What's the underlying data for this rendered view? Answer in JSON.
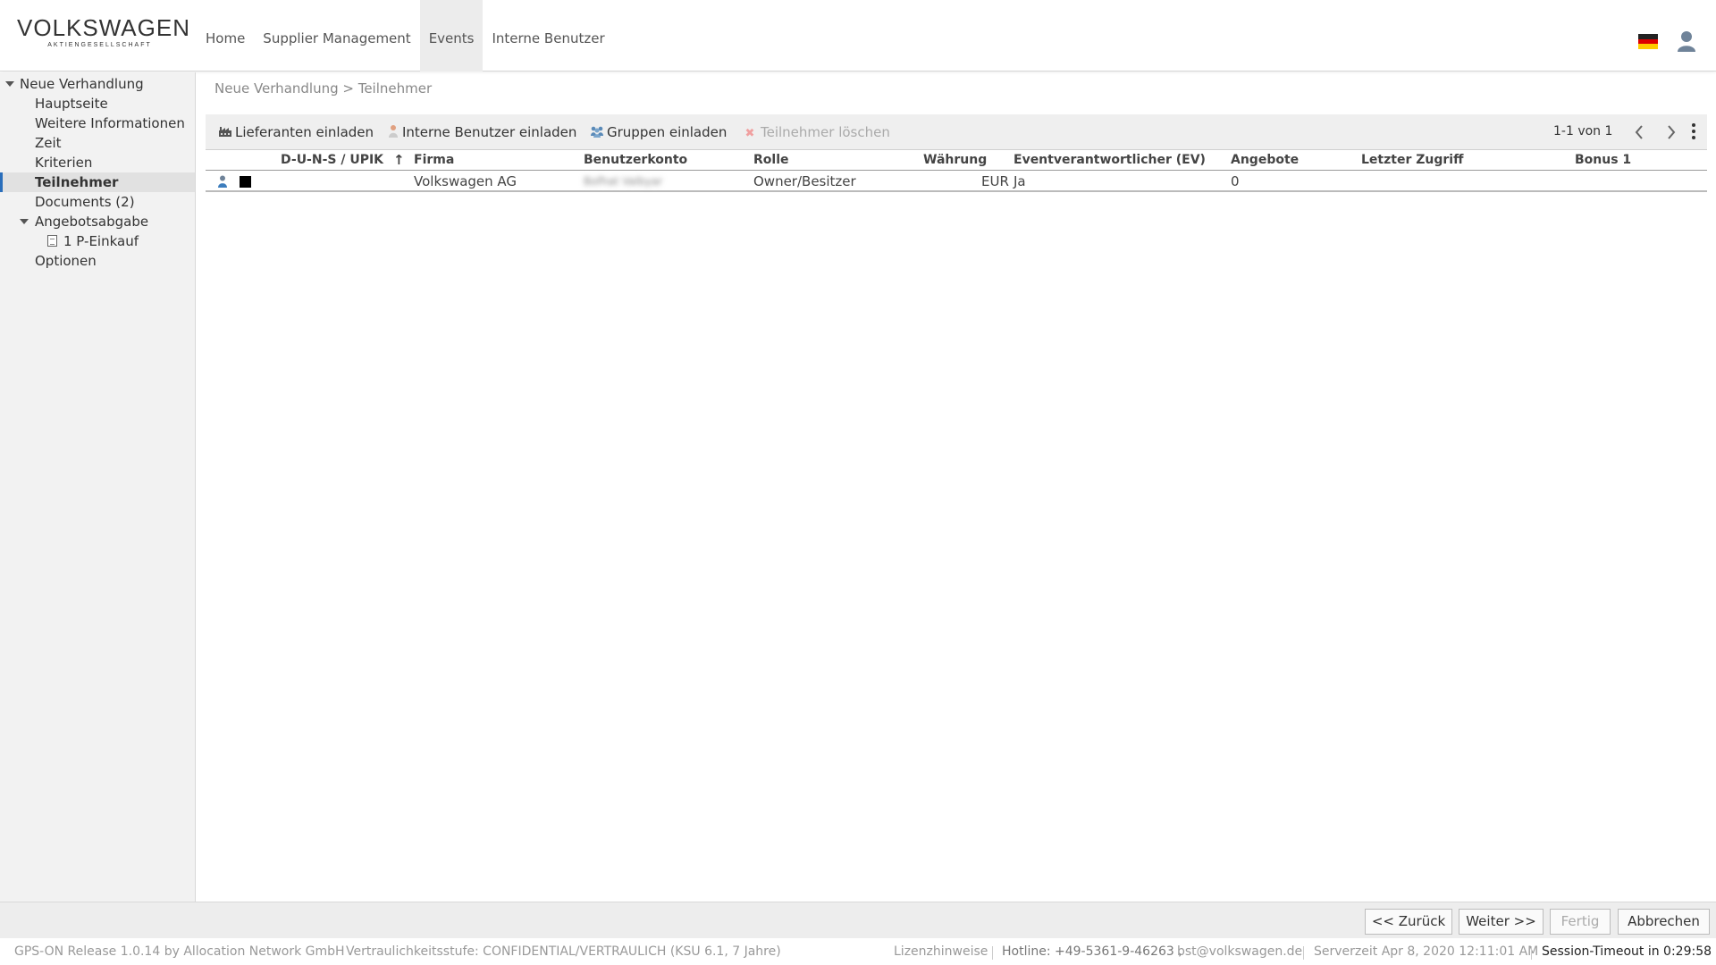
{
  "brand": {
    "logo_main": "VOLKSWAGEN",
    "logo_sub": "AKTIENGESELLSCHAFT"
  },
  "nav": {
    "items": [
      {
        "label": "Home",
        "active": false
      },
      {
        "label": "Supplier Management",
        "active": false
      },
      {
        "label": "Events",
        "active": true
      },
      {
        "label": "Interne Benutzer",
        "active": false
      }
    ]
  },
  "header_icons": {
    "language": "flag-de-icon",
    "user": "user-icon"
  },
  "sidebar": {
    "items": [
      {
        "label": "Neue Verhandlung",
        "level": 0,
        "expanded": true
      },
      {
        "label": "Hauptseite",
        "level": 1
      },
      {
        "label": "Weitere Informationen",
        "level": 1
      },
      {
        "label": "Zeit",
        "level": 1
      },
      {
        "label": "Kriterien",
        "level": 1
      },
      {
        "label": "Teilnehmer",
        "level": 1,
        "selected": true
      },
      {
        "label": "Documents (2)",
        "level": 1
      },
      {
        "label": "Angebotsabgabe",
        "level": 1,
        "expanded": true
      },
      {
        "label": "1 P-Einkauf",
        "level": 2,
        "icon": "document-icon"
      },
      {
        "label": "Optionen",
        "level": 1
      }
    ]
  },
  "breadcrumb": "Neue Verhandlung > Teilnehmer",
  "toolbar": {
    "invite_suppliers": "Lieferanten einladen",
    "invite_internal": "Interne Benutzer einladen",
    "invite_groups": "Gruppen einladen",
    "delete_participants": "Teilnehmer löschen",
    "pager": "1-1 von 1"
  },
  "table": {
    "columns": [
      "D-U-N-S / UPIK",
      "Firma",
      "Benutzerkonto",
      "Rolle",
      "Währung",
      "Eventverantwortlicher (EV)",
      "Angebote",
      "Letzter Zugriff",
      "Bonus 1"
    ],
    "sort_indicator": "↑",
    "rows": [
      {
        "duns": "",
        "firma": "Volkswagen AG",
        "benutzerkonto": "Bofhat Valbyar",
        "rolle": "Owner/Besitzer",
        "waehrung": "EUR",
        "ev": "Ja",
        "angebote": "0",
        "letzter_zugriff": "",
        "bonus1": "",
        "color": "#000000"
      }
    ]
  },
  "footer_buttons": {
    "back": "<< Zurück",
    "next": "Weiter >>",
    "finish": "Fertig",
    "cancel": "Abbrechen"
  },
  "status": {
    "release": "GPS-ON Release 1.0.14 by Allocation Network GmbH",
    "confidentiality": "Vertraulichkeitsstufe: CONFIDENTIAL/VERTRAULICH (KSU 6.1, 7 Jahre)",
    "license": "Lizenzhinweise",
    "hotline": "Hotline:  +49-5361-9-46263 ,",
    "email": "bst@volkswagen.de",
    "server_time": "Serverzeit Apr 8, 2020 12:11:01 AM",
    "session": "Session-Timeout in 0:29:58"
  },
  "colors": {
    "selected_border": "#2a6ebb",
    "sidebar_bg": "#f2f2f2",
    "toolbar_bg": "#efefef"
  }
}
